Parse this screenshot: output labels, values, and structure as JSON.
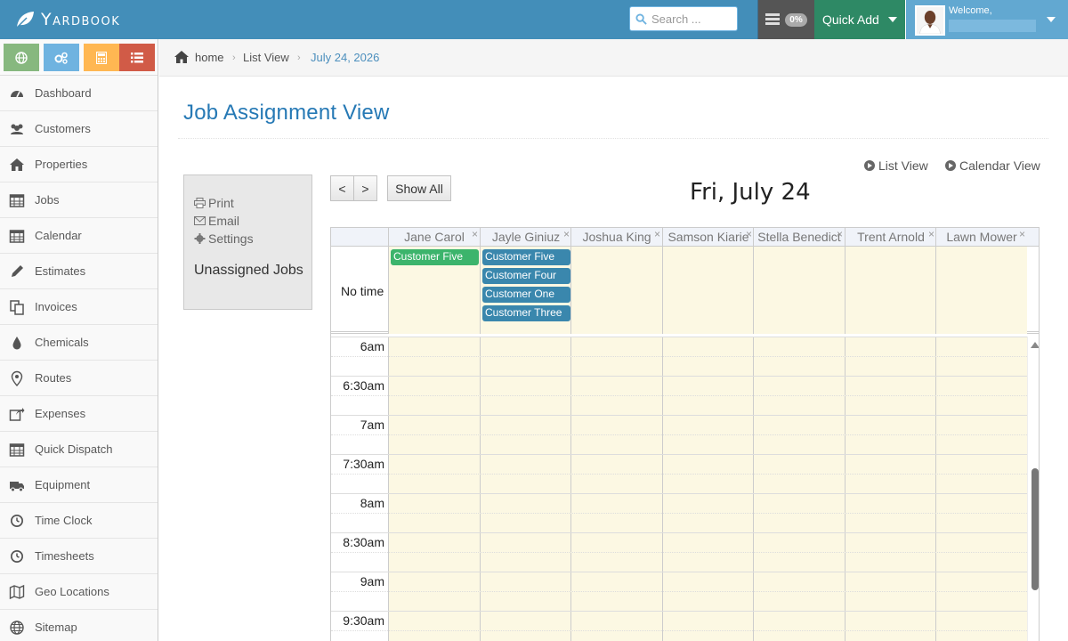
{
  "app": {
    "name": "Yardbook"
  },
  "header": {
    "search_placeholder": "Search ...",
    "tasks_badge": "0%",
    "quick_add": "Quick Add",
    "welcome": "Welcome,"
  },
  "sidebar": {
    "shortcuts": [
      {
        "icon": "globe-icon",
        "color": "#87b87f"
      },
      {
        "icon": "cogs-icon",
        "color": "#6fb3e0"
      },
      {
        "icon": "calculator-icon",
        "color": "#ffb752"
      },
      {
        "icon": "list-icon",
        "color": "#d15b47"
      }
    ],
    "items": [
      {
        "label": "Dashboard",
        "icon": "dashboard-icon"
      },
      {
        "label": "Customers",
        "icon": "users-icon"
      },
      {
        "label": "Properties",
        "icon": "home-icon"
      },
      {
        "label": "Jobs",
        "icon": "calendar-icon"
      },
      {
        "label": "Calendar",
        "icon": "calendar-icon"
      },
      {
        "label": "Estimates",
        "icon": "pencil-icon"
      },
      {
        "label": "Invoices",
        "icon": "copy-icon"
      },
      {
        "label": "Chemicals",
        "icon": "droplet-icon"
      },
      {
        "label": "Routes",
        "icon": "map-marker-icon"
      },
      {
        "label": "Expenses",
        "icon": "share-icon"
      },
      {
        "label": "Quick Dispatch",
        "icon": "calendar-icon"
      },
      {
        "label": "Equipment",
        "icon": "truck-icon"
      },
      {
        "label": "Time Clock",
        "icon": "clock-icon"
      },
      {
        "label": "Timesheets",
        "icon": "clock-icon"
      },
      {
        "label": "Geo Locations",
        "icon": "map-icon"
      },
      {
        "label": "Sitemap",
        "icon": "globe-icon"
      }
    ]
  },
  "breadcrumb": {
    "home": "home",
    "list_view": "List View",
    "current": "July 24, 2026"
  },
  "page": {
    "title": "Job Assignment View",
    "list_view_link": "List View",
    "calendar_view_link": "Calendar View",
    "panel": {
      "print": "Print",
      "email": "Email",
      "settings": "Settings",
      "unassigned": "Unassigned Jobs"
    },
    "prev": "<",
    "next": ">",
    "show_all": "Show All",
    "date": "Fri, July 24"
  },
  "calendar": {
    "no_time_label": "No time",
    "close_glyph": "×",
    "columns": [
      {
        "name": "Jane Carol",
        "events": [
          {
            "label": "Customer Five",
            "color": "#3cb46c"
          }
        ]
      },
      {
        "name": "Jayle Giniuz",
        "events": [
          {
            "label": "Customer Five",
            "color": "#3a87ad"
          },
          {
            "label": "Customer Four",
            "color": "#3a87ad"
          },
          {
            "label": "Customer One",
            "color": "#3a87ad"
          },
          {
            "label": "Customer Three",
            "color": "#3a87ad"
          }
        ]
      },
      {
        "name": "Joshua King",
        "events": []
      },
      {
        "name": "Samson Kiarie",
        "events": []
      },
      {
        "name": "Stella Benedict",
        "events": []
      },
      {
        "name": "Trent Arnold",
        "events": []
      },
      {
        "name": "Lawn Mower",
        "events": []
      }
    ],
    "times": [
      "6am",
      "6:30am",
      "7am",
      "7:30am",
      "8am",
      "8:30am",
      "9am",
      "9:30am"
    ]
  }
}
